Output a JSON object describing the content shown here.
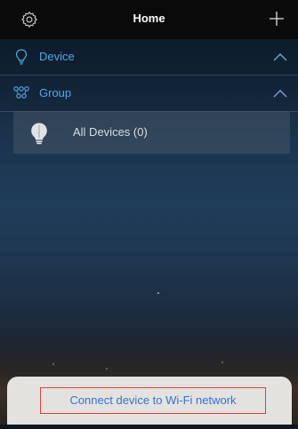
{
  "header": {
    "title": "Home",
    "left_icon": "gear-icon",
    "right_icon": "plus-icon"
  },
  "sections": {
    "device": {
      "label": "Device",
      "icon": "bulb-outline-icon",
      "expanded": true
    },
    "group": {
      "label": "Group",
      "icon": "group-nodes-icon",
      "expanded": true
    }
  },
  "group_items": [
    {
      "label": "All Devices (0)",
      "icon": "bulb-icon"
    }
  ],
  "action_sheet": {
    "button_label": "Connect device to Wi-Fi network"
  },
  "colors": {
    "accent": "#4fa9e8",
    "link": "#2f74d0",
    "highlight_border": "#e04040",
    "header_bg": "#0a0a0a"
  }
}
